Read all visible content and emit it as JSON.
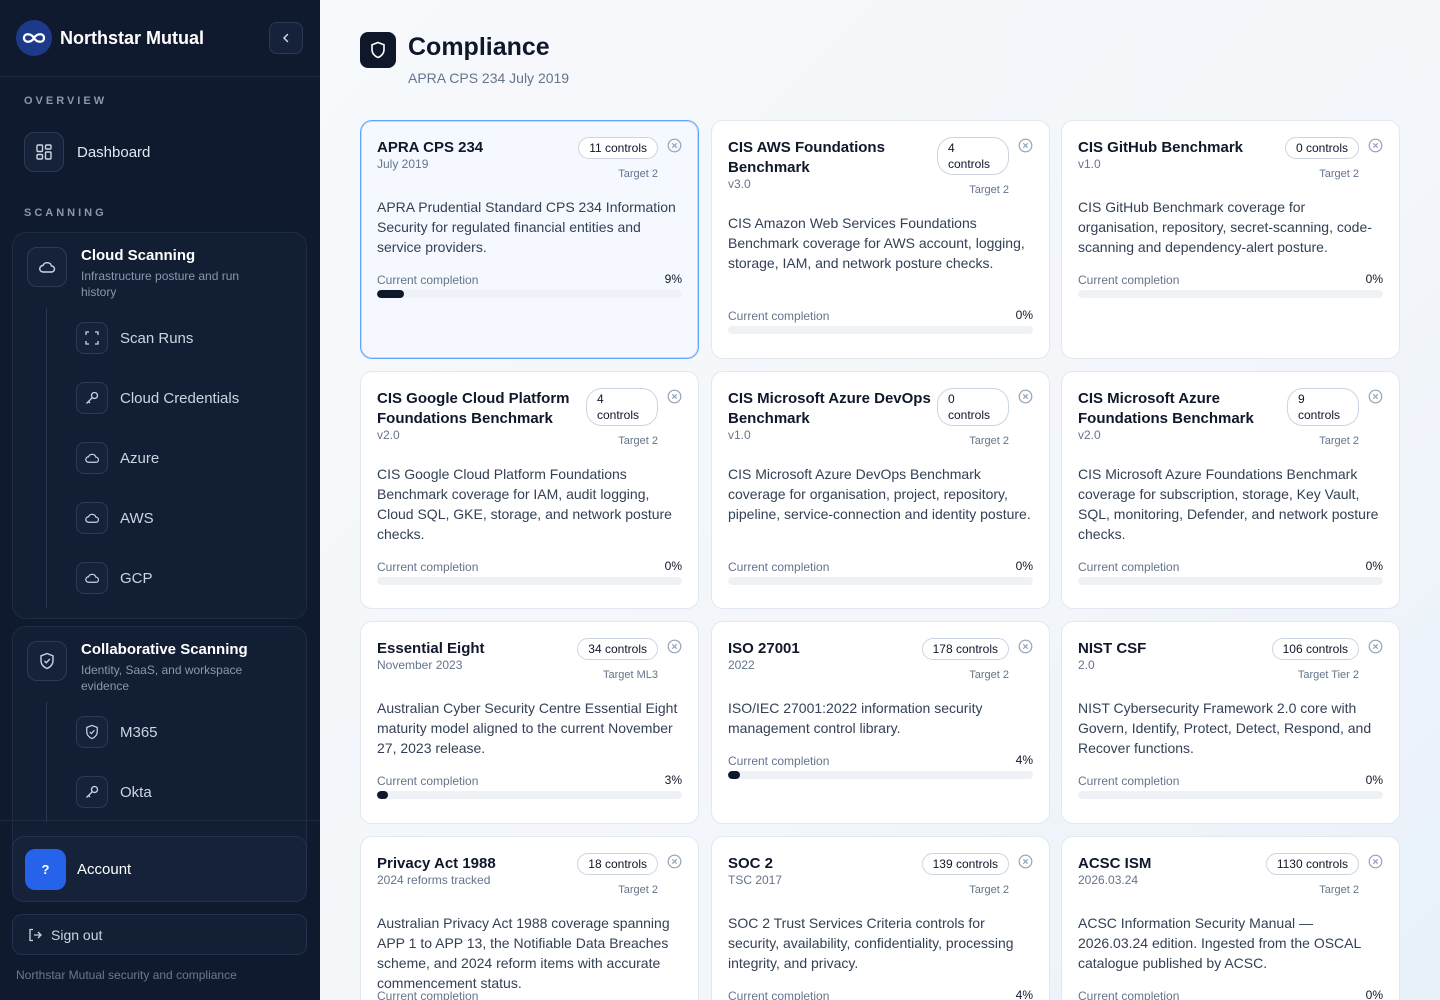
{
  "brand": {
    "name": "Northstar Mutual"
  },
  "nav": {
    "overview_label": "OVERVIEW",
    "dashboard_label": "Dashboard",
    "scanning_label": "SCANNING",
    "cloud": {
      "title": "Cloud Scanning",
      "subtitle": "Infrastructure posture and run history",
      "items": [
        "Scan Runs",
        "Cloud Credentials",
        "Azure",
        "AWS",
        "GCP"
      ]
    },
    "collab": {
      "title": "Collaborative Scanning",
      "subtitle": "Identity, SaaS, and workspace evidence",
      "items": [
        "M365",
        "Okta"
      ]
    },
    "account_label": "Account",
    "account_initial": "?",
    "signout_label": "Sign out",
    "footer": "Northstar Mutual security and compliance"
  },
  "page": {
    "title": "Compliance",
    "subtitle": "APRA CPS 234 July 2019"
  },
  "completion_label": "Current completion",
  "cards": [
    {
      "name": "APRA CPS 234",
      "version": "July 2019",
      "controls": "11 controls",
      "target": "Target 2",
      "description": "APRA Prudential Standard CPS 234 Information Security for regulated financial entities and service providers.",
      "completion_text": "9%",
      "completion": 0.09
    },
    {
      "name": "CIS AWS Foundations Benchmark",
      "version": "v3.0",
      "controls": "4 controls",
      "target": "Target 2",
      "description": "CIS Amazon Web Services Foundations Benchmark coverage for AWS account, logging, storage, IAM, and network posture checks.",
      "completion_text": "0%",
      "completion": 0
    },
    {
      "name": "CIS GitHub Benchmark",
      "version": "v1.0",
      "controls": "0 controls",
      "target": "Target 2",
      "description": "CIS GitHub Benchmark coverage for organisation, repository, secret-scanning, code-scanning and dependency-alert posture.",
      "completion_text": "0%",
      "completion": 0
    },
    {
      "name": "CIS Google Cloud Platform Foundations Benchmark",
      "version": "v2.0",
      "controls": "4 controls",
      "target": "Target 2",
      "description": "CIS Google Cloud Platform Foundations Benchmark coverage for IAM, audit logging, Cloud SQL, GKE, storage, and network posture checks.",
      "completion_text": "0%",
      "completion": 0
    },
    {
      "name": "CIS Microsoft Azure DevOps Benchmark",
      "version": "v1.0",
      "controls": "0 controls",
      "target": "Target 2",
      "description": "CIS Microsoft Azure DevOps Benchmark coverage for organisation, project, repository, pipeline, service-connection and identity posture.",
      "completion_text": "0%",
      "completion": 0
    },
    {
      "name": "CIS Microsoft Azure Foundations Benchmark",
      "version": "v2.0",
      "controls": "9 controls",
      "target": "Target 2",
      "description": "CIS Microsoft Azure Foundations Benchmark coverage for subscription, storage, Key Vault, SQL, monitoring, Defender, and network posture checks.",
      "completion_text": "0%",
      "completion": 0
    },
    {
      "name": "Essential Eight",
      "version": "November 2023",
      "controls": "34 controls",
      "target": "Target ML3",
      "description": "Australian Cyber Security Centre Essential Eight maturity model aligned to the current November 27, 2023 release.",
      "completion_text": "3%",
      "completion": 0.03
    },
    {
      "name": "ISO 27001",
      "version": "2022",
      "controls": "178 controls",
      "target": "Target 2",
      "description": "ISO/IEC 27001:2022 information security management control library.",
      "completion_text": "4%",
      "completion": 0.04
    },
    {
      "name": "NIST CSF",
      "version": "2.0",
      "controls": "106 controls",
      "target": "Target Tier 2",
      "description": "NIST Cybersecurity Framework 2.0 core with Govern, Identify, Protect, Detect, Respond, and Recover functions.",
      "completion_text": "0%",
      "completion": 0
    },
    {
      "name": "Privacy Act 1988",
      "version": "2024 reforms tracked",
      "controls": "18 controls",
      "target": "Target 2",
      "description": "Australian Privacy Act 1988 coverage spanning APP 1 to APP 13, the Notifiable Data Breaches scheme, and 2024 reform items with accurate commencement status.",
      "completion_text": "",
      "completion": null
    },
    {
      "name": "SOC 2",
      "version": "TSC 2017",
      "controls": "139 controls",
      "target": "Target 2",
      "description": "SOC 2 Trust Services Criteria controls for security, availability, confidentiality, processing integrity, and privacy.",
      "completion_text": "4%",
      "completion": 0.04
    },
    {
      "name": "ACSC ISM",
      "version": "2026.03.24",
      "controls": "1130 controls",
      "target": "Target 2",
      "description": "ACSC Information Security Manual — 2026.03.24 edition. Ingested from the OSCAL catalogue published by ACSC.",
      "completion_text": "0%",
      "completion": 0
    }
  ],
  "colors": {
    "sidebar": "#0f1a2e",
    "accent": "#2563eb",
    "active_border": "#60a5fa",
    "bar_fill": "#0f172a"
  }
}
